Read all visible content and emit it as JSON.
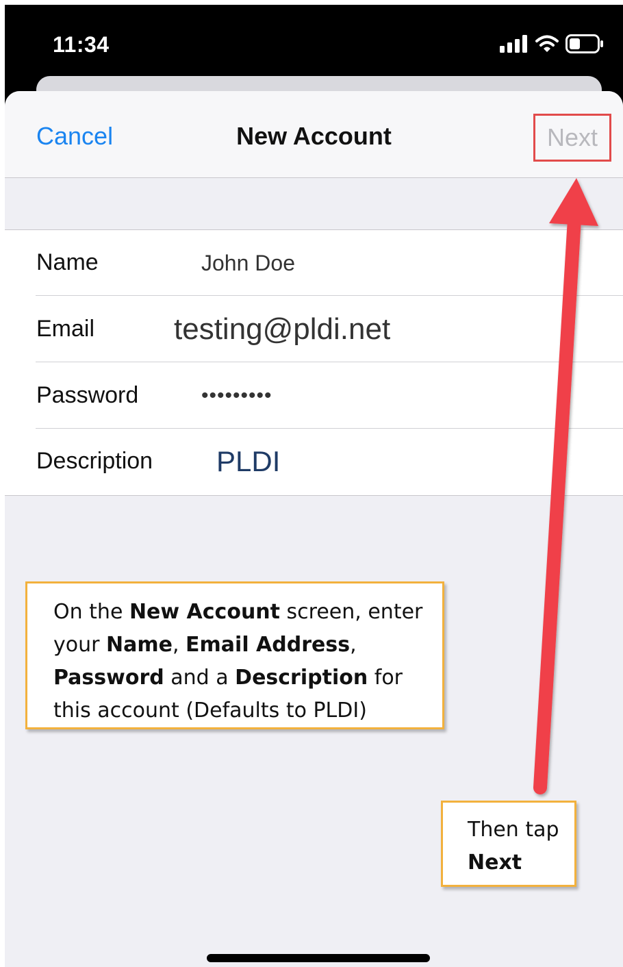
{
  "status_bar": {
    "time": "11:34",
    "icons": [
      "signal-icon",
      "wifi-icon",
      "battery-icon"
    ]
  },
  "nav": {
    "cancel_label": "Cancel",
    "title": "New Account",
    "next_label": "Next"
  },
  "form": {
    "rows": [
      {
        "label": "Name",
        "value": "John Doe"
      },
      {
        "label": "Email",
        "value": "testing@pldi.net"
      },
      {
        "label": "Password",
        "value": "•••••••••"
      },
      {
        "label": "Description",
        "value": "PLDI"
      }
    ]
  },
  "callout_main": {
    "t1": "On the ",
    "b1": "New Account",
    "t2": " screen, enter your ",
    "b2": "Name",
    "t3": ", ",
    "b3": "Email Address",
    "t4": ", ",
    "b4": "Password",
    "t5": " and a ",
    "b5": "Description",
    "t6": " for this account (Defaults to PLDI)"
  },
  "callout_next": {
    "t1": "Then tap",
    "b1": "Next"
  },
  "colors": {
    "link_blue": "#1a84f0",
    "highlight_red": "#e24b4b",
    "callout_border": "#f2b13d",
    "arrow_red": "#f0404a"
  }
}
